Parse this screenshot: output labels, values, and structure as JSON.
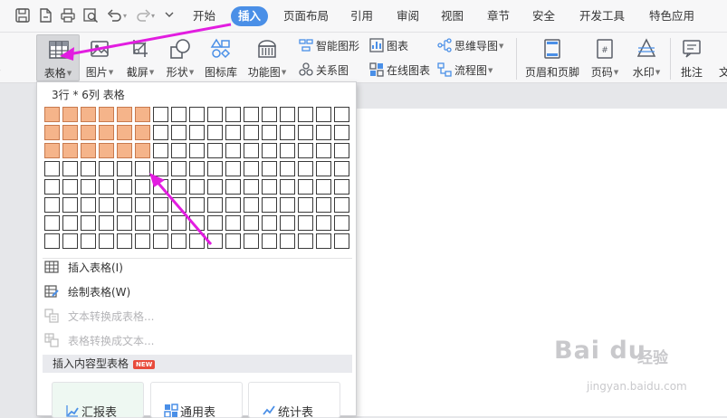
{
  "colors": {
    "accent_tab": "#4a8fe7",
    "selected_cell": "#f5b48a",
    "annotation_arrow": "#e21de0",
    "new_badge": "#e84b3c"
  },
  "quick_access": {
    "icons": [
      "save-icon",
      "export-pdf-icon",
      "print-icon",
      "print-preview-icon",
      "undo-icon",
      "redo-icon",
      "customize-icon"
    ]
  },
  "menu_tabs": [
    "开始",
    "插入",
    "页面布局",
    "引用",
    "审阅",
    "视图",
    "章节",
    "安全",
    "开发工具",
    "特色应用"
  ],
  "active_tab": "插入",
  "ribbon": {
    "page_partial": "页",
    "table": "表格",
    "picture": "图片",
    "screenshot": "截屏",
    "shapes": "形状",
    "icon_library": "图标库",
    "function_chart": "功能图",
    "smart_art": "智能图形",
    "chart": "图表",
    "mind_map": "思维导图",
    "relation_chart": "关系图",
    "online_chart": "在线图表",
    "flowchart": "流程图",
    "header_footer": "页眉和页脚",
    "page_number": "页码",
    "watermark": "水印",
    "comment": "批注",
    "text_partial": "文"
  },
  "dropdown": {
    "grid_label": "3行 * 6列 表格",
    "grid_rows": 8,
    "grid_cols": 17,
    "selected_rows": 3,
    "selected_cols": 6,
    "insert_table": "插入表格(I)",
    "draw_table": "绘制表格(W)",
    "text_to_table": "文本转换成表格...",
    "table_to_text": "表格转换成文本...",
    "content_tables_header": "插入内容型表格",
    "new_badge": "NEW",
    "templates": [
      "汇报表",
      "通用表",
      "统计表"
    ]
  },
  "watermark": {
    "logo": "Bai du",
    "logo_cn": "经验",
    "url": "jingyan.baidu.com"
  }
}
